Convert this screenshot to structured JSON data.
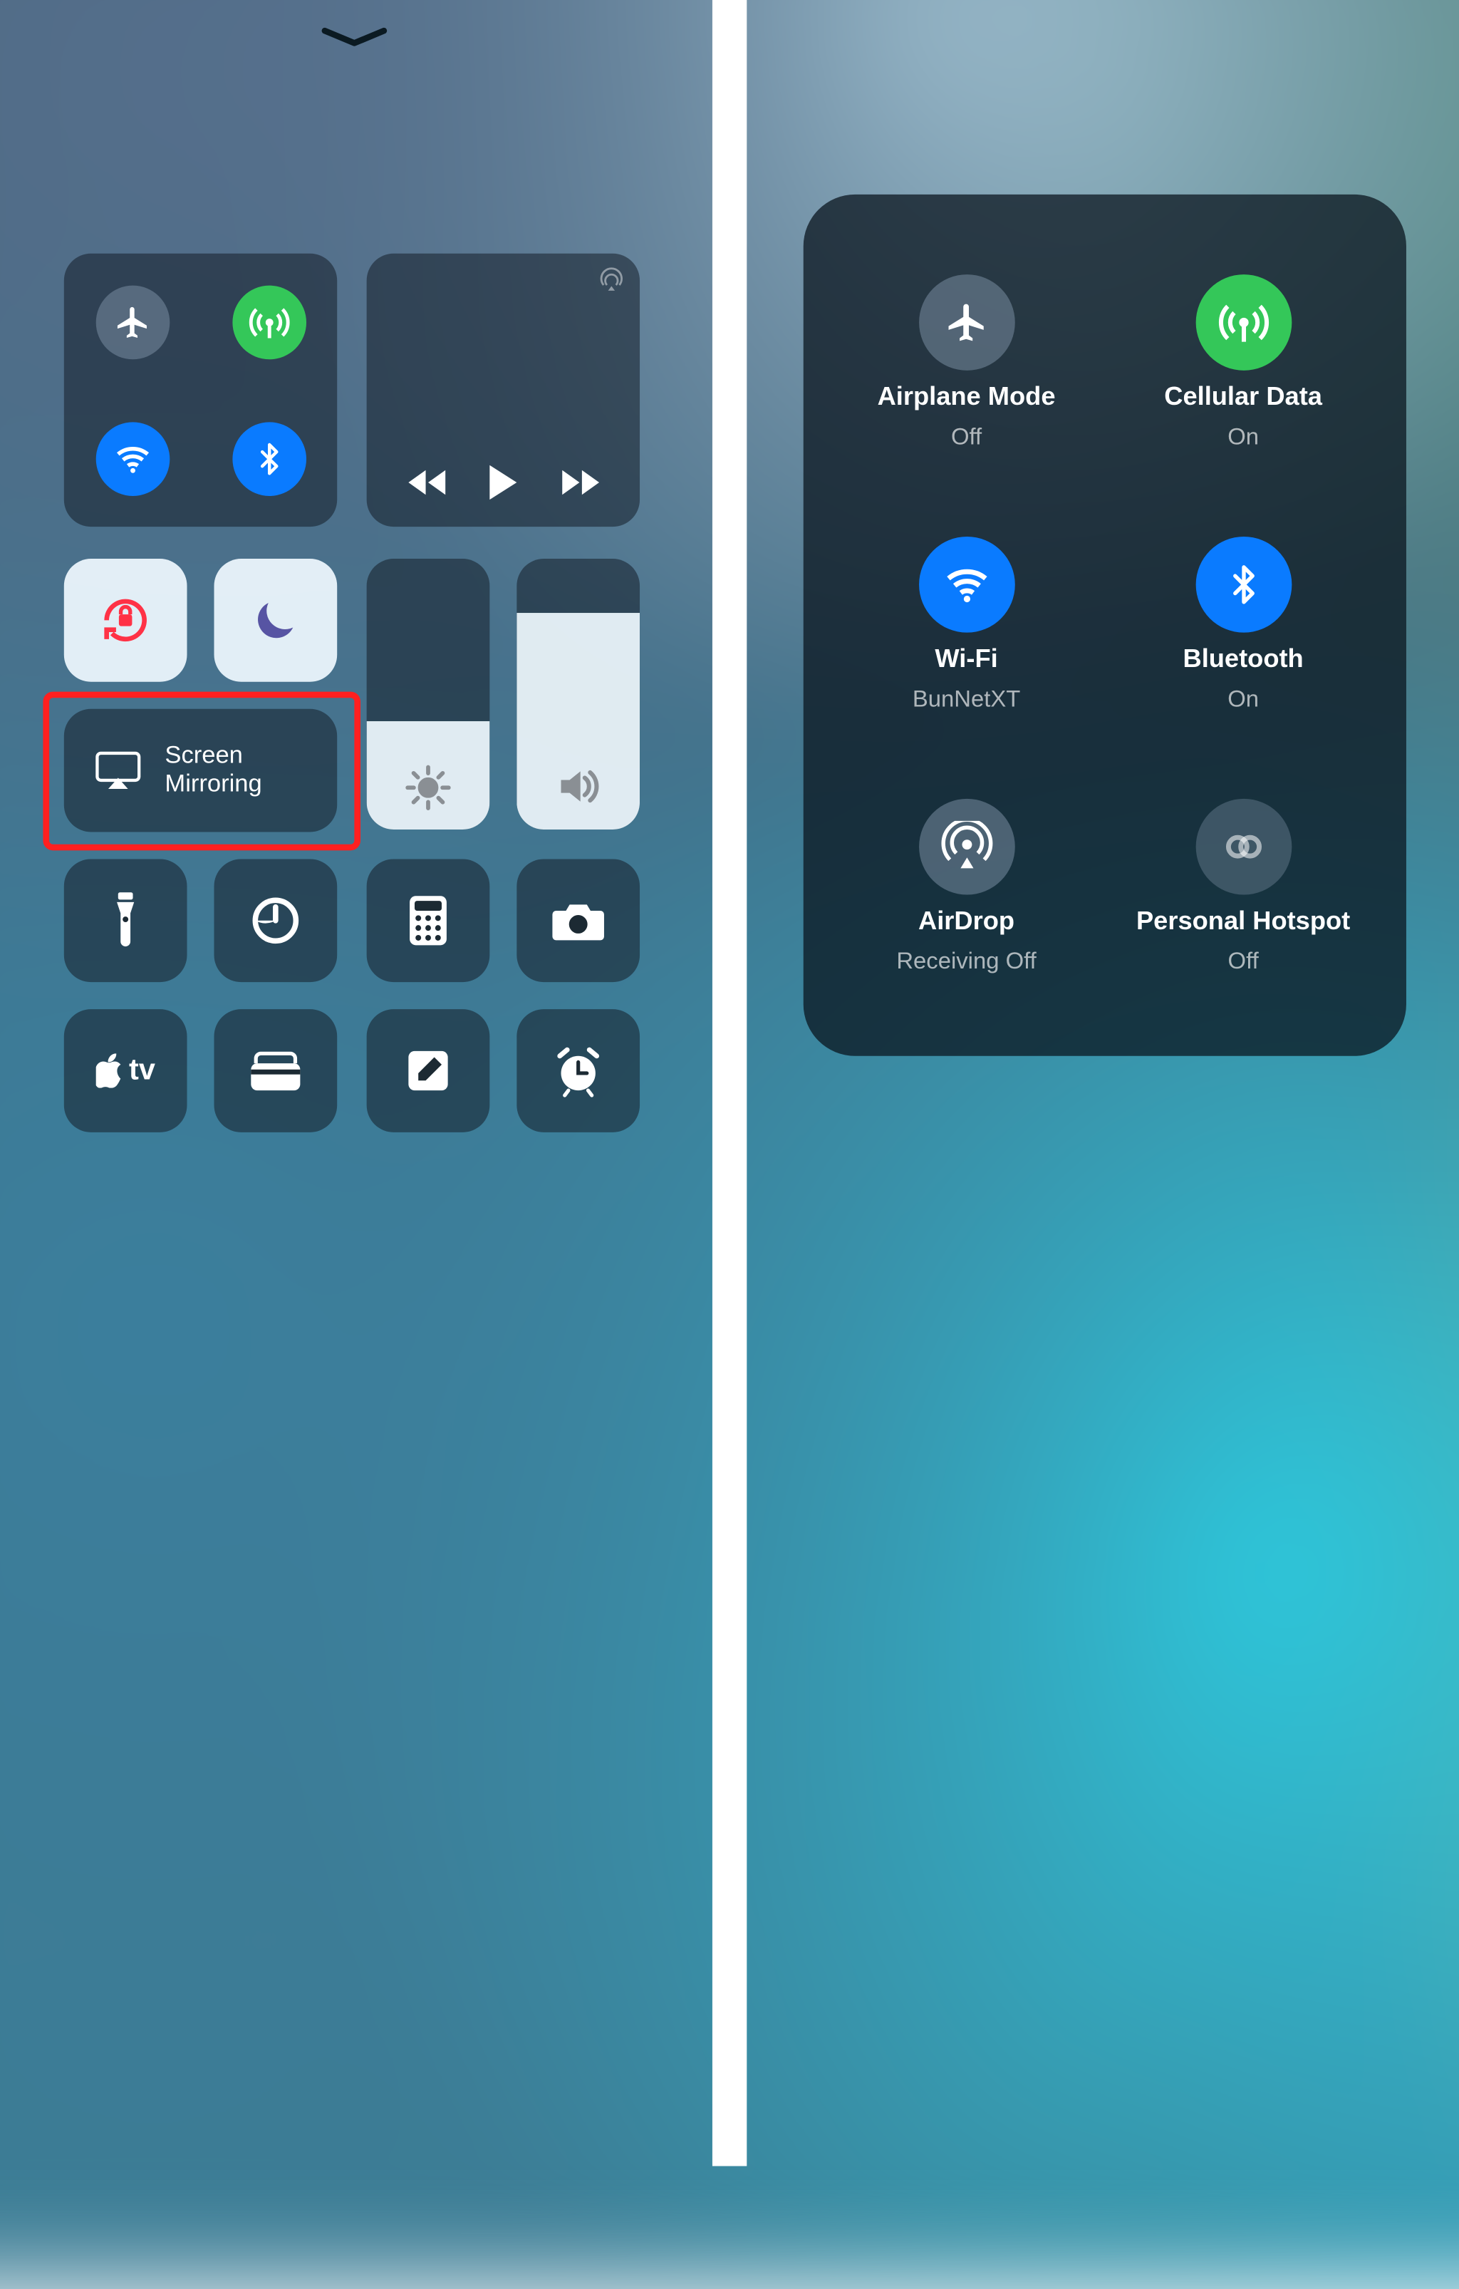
{
  "left": {
    "screen_mirroring_label": "Screen\nMirroring",
    "appletv_label": "tv",
    "brightness_pct": 40,
    "volume_pct": 80
  },
  "panel": {
    "airplane": {
      "title": "Airplane Mode",
      "sub": "Off"
    },
    "cellular": {
      "title": "Cellular Data",
      "sub": "On"
    },
    "wifi": {
      "title": "Wi-Fi",
      "sub": "BunNetXT"
    },
    "bluetooth": {
      "title": "Bluetooth",
      "sub": "On"
    },
    "airdrop": {
      "title": "AirDrop",
      "sub": "Receiving Off"
    },
    "hotspot": {
      "title": "Personal Hotspot",
      "sub": "Off"
    }
  }
}
